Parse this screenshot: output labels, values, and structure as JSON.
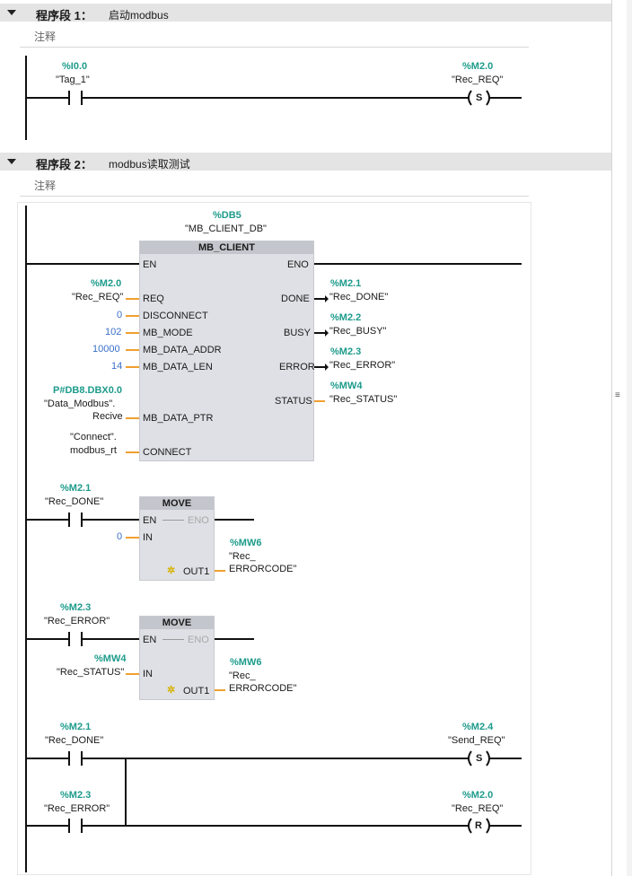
{
  "segments": [
    {
      "title": "程序段 1：",
      "name": "启动modbus",
      "comment": "注释"
    },
    {
      "title": "程序段 2：",
      "name": "modbus读取测试",
      "comment": "注释"
    }
  ],
  "seg1": {
    "contact": {
      "addr": "%I0.0",
      "tag": "\"Tag_1\""
    },
    "coil": {
      "addr": "%M2.0",
      "tag": "\"Rec_REQ\"",
      "type": "S"
    }
  },
  "mb_client": {
    "db_addr": "%DB5",
    "db_tag": "\"MB_CLIENT_DB\"",
    "title": "MB_CLIENT",
    "pin_en": "EN",
    "pin_eno": "ENO",
    "inputs": [
      {
        "pin": "REQ",
        "addr": "%M2.0",
        "tag": "\"Rec_REQ\""
      },
      {
        "pin": "DISCONNECT",
        "value": "0"
      },
      {
        "pin": "MB_MODE",
        "value": "102"
      },
      {
        "pin": "MB_DATA_ADDR",
        "value": "10000"
      },
      {
        "pin": "MB_DATA_LEN",
        "value": "14"
      },
      {
        "pin": "MB_DATA_PTR",
        "addr": "P#DB8.DBX0.0",
        "tag_line1": "\"Data_Modbus\".",
        "tag_line2": "Recive"
      },
      {
        "pin": "CONNECT",
        "tag_line1": "\"Connect\".",
        "tag_line2": "modbus_rt"
      }
    ],
    "outputs": [
      {
        "pin": "DONE",
        "addr": "%M2.1",
        "tag": "\"Rec_DONE\""
      },
      {
        "pin": "BUSY",
        "addr": "%M2.2",
        "tag": "\"Rec_BUSY\""
      },
      {
        "pin": "ERROR",
        "addr": "%M2.3",
        "tag": "\"Rec_ERROR\""
      },
      {
        "pin": "STATUS",
        "addr": "%MW4",
        "tag": "\"Rec_STATUS\""
      }
    ]
  },
  "move1": {
    "contact": {
      "addr": "%M2.1",
      "tag": "\"Rec_DONE\""
    },
    "title": "MOVE",
    "pin_en": "EN",
    "pin_eno": "ENO",
    "pin_in": "IN",
    "pin_out": "OUT1",
    "in_value": "0",
    "out": {
      "addr": "%MW6",
      "tag_line1": "\"Rec_",
      "tag_line2": "ERRORCODE\""
    }
  },
  "move2": {
    "contact": {
      "addr": "%M2.3",
      "tag": "\"Rec_ERROR\""
    },
    "title": "MOVE",
    "pin_en": "EN",
    "pin_eno": "ENO",
    "pin_in": "IN",
    "pin_out": "OUT1",
    "in": {
      "addr": "%MW4",
      "tag": "\"Rec_STATUS\""
    },
    "out": {
      "addr": "%MW6",
      "tag_line1": "\"Rec_",
      "tag_line2": "ERRORCODE\""
    }
  },
  "rung_last": {
    "contact1": {
      "addr": "%M2.1",
      "tag": "\"Rec_DONE\""
    },
    "coil1": {
      "addr": "%M2.4",
      "tag": "\"Send_REQ\"",
      "type": "S"
    },
    "contact2": {
      "addr": "%M2.3",
      "tag": "\"Rec_ERROR\""
    },
    "coil2": {
      "addr": "%M2.0",
      "tag": "\"Rec_REQ\"",
      "type": "R"
    }
  },
  "colors": {
    "address": "#1d9b8b",
    "literal": "#3a6fc9",
    "wire_stub": "#f0a030",
    "box_fill": "#dfe0e6",
    "box_title": "#c4c6cd"
  },
  "scrollbar": {
    "grip_icon": "≡"
  }
}
